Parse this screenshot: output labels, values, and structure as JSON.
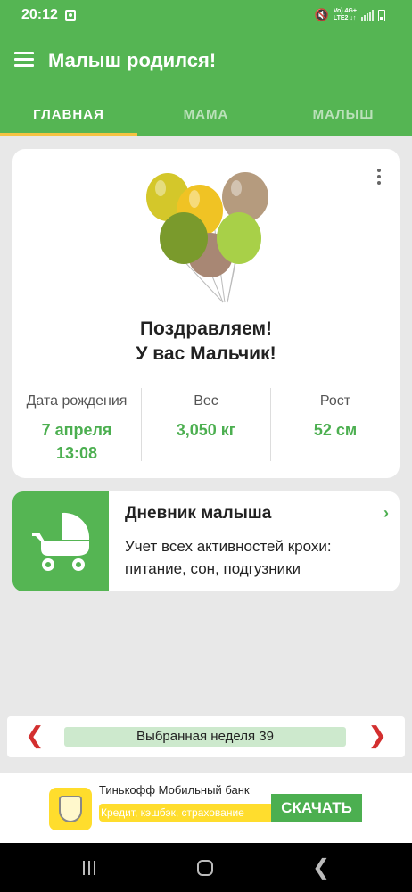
{
  "status": {
    "time": "20:12",
    "network_top": "Vo) 4G+",
    "network_bottom": "LTE2 ↓↑"
  },
  "appbar": {
    "title": "Малыш родился!"
  },
  "tabs": [
    {
      "label": "ГЛАВНАЯ",
      "active": true
    },
    {
      "label": "МАМА",
      "active": false
    },
    {
      "label": "МАЛЫШ",
      "active": false
    }
  ],
  "card": {
    "congrats_line1": "Поздравляем!",
    "congrats_line2": "У вас Мальчик!",
    "stats": [
      {
        "label": "Дата рождения",
        "value_line1": "7 апреля",
        "value_line2": "13:08"
      },
      {
        "label": "Вес",
        "value_line1": "3,050 кг",
        "value_line2": ""
      },
      {
        "label": "Рост",
        "value_line1": "52 см",
        "value_line2": ""
      }
    ]
  },
  "diary": {
    "title": "Дневник малыша",
    "subtitle": "Учет всех активностей крохи: питание, сон, подгузники"
  },
  "week": {
    "label": "Выбранная неделя 39"
  },
  "ad": {
    "title": "Тинькофф Мобильный банк",
    "subtitle": "Кредит, кэшбэк, страхование",
    "button": "СКАЧАТЬ"
  },
  "colors": {
    "primary_green": "#55b553",
    "accent_yellow": "#f5c242",
    "value_green": "#4caf50",
    "arrow_red": "#d32f2f"
  }
}
